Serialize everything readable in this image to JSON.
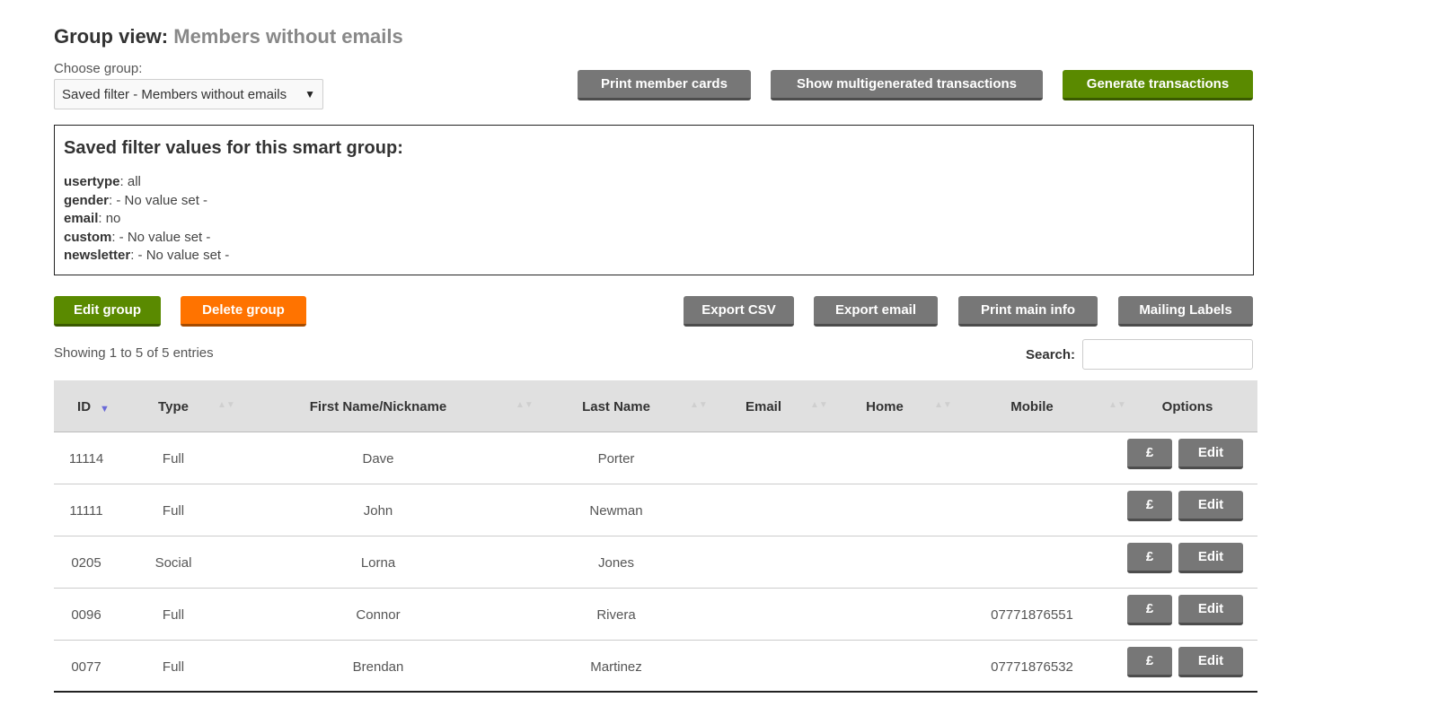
{
  "header": {
    "title_prefix": "Group view:",
    "title_group": "Members without emails"
  },
  "group_select": {
    "label": "Choose group:",
    "value": "Saved filter - Members without emails"
  },
  "top_buttons": {
    "print_cards": "Print member cards",
    "show_multi": "Show multigenerated transactions",
    "generate": "Generate transactions"
  },
  "filter": {
    "title": "Saved filter values for this smart group:",
    "items": [
      {
        "key": "usertype",
        "value": ": all"
      },
      {
        "key": "gender",
        "value": ": - No value set -"
      },
      {
        "key": "email",
        "value": ": no"
      },
      {
        "key": "custom",
        "value": ": - No value set -"
      },
      {
        "key": "newsletter",
        "value": ": - No value set -"
      }
    ]
  },
  "actions": {
    "edit_group": "Edit group",
    "delete_group": "Delete group",
    "export_csv": "Export CSV",
    "export_email": "Export email",
    "print_main": "Print main info",
    "mailing_labels": "Mailing Labels"
  },
  "table_info": {
    "showing": "Showing 1 to 5 of 5 entries",
    "search_label": "Search:"
  },
  "table": {
    "columns": [
      "ID",
      "Type",
      "First Name/Nickname",
      "Last Name",
      "Email",
      "Home",
      "Mobile",
      "Options"
    ],
    "rows": [
      {
        "id": "11114",
        "type": "Full",
        "first": "Dave",
        "last": "Porter",
        "email": "",
        "home": "",
        "mobile": ""
      },
      {
        "id": "11111",
        "type": "Full",
        "first": "John",
        "last": "Newman",
        "email": "",
        "home": "",
        "mobile": ""
      },
      {
        "id": "0205",
        "type": "Social",
        "first": "Lorna",
        "last": "Jones",
        "email": "",
        "home": "",
        "mobile": ""
      },
      {
        "id": "0096",
        "type": "Full",
        "first": "Connor",
        "last": "Rivera",
        "email": "",
        "home": "",
        "mobile": "07771876551"
      },
      {
        "id": "0077",
        "type": "Full",
        "first": "Brendan",
        "last": "Martinez",
        "email": "",
        "home": "",
        "mobile": "07771876532"
      }
    ],
    "pay_label": "£",
    "edit_label": "Edit"
  },
  "colors": {
    "green": "#5a8a00",
    "orange": "#ff7300",
    "grey": "#777777",
    "header_bg": "#e0e0e0"
  }
}
